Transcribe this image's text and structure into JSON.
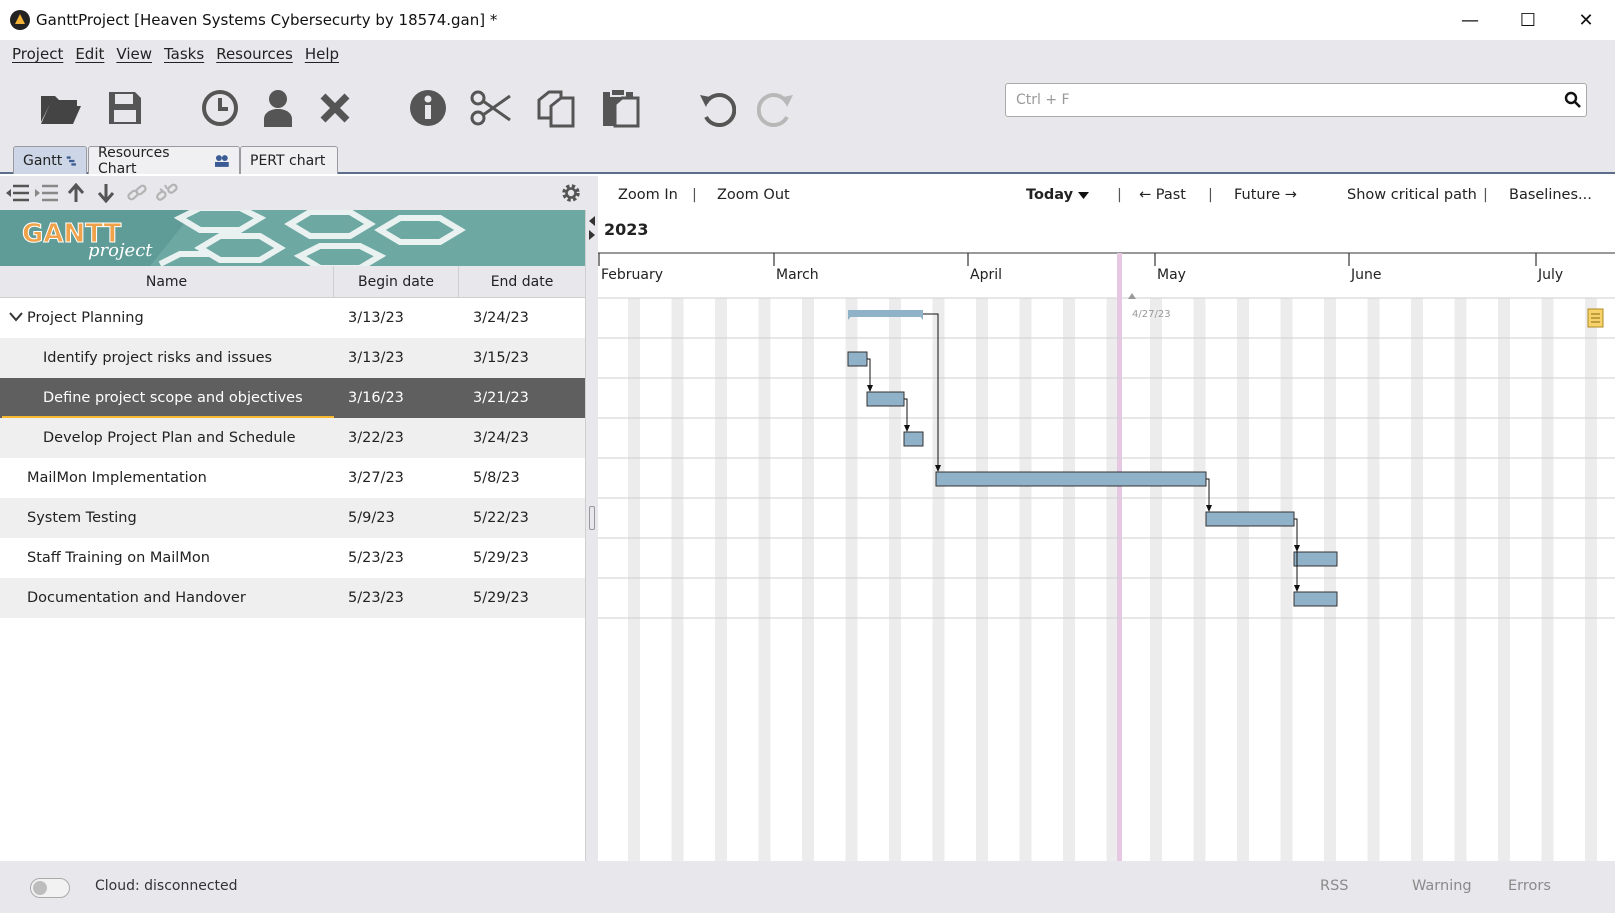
{
  "window": {
    "title": "GanttProject [Heaven Systems Cybersecurty by 18574.gan] *",
    "controls": [
      "—",
      "☐",
      "✕"
    ]
  },
  "menu": [
    "Project",
    "Edit",
    "View",
    "Tasks",
    "Resources",
    "Help"
  ],
  "toolbar": {
    "icons": [
      "folder-open-icon",
      "save-icon",
      "history-clock-icon",
      "person-icon",
      "delete-x-icon",
      "info-icon",
      "cut-scissors-icon",
      "copy-icon",
      "paste-icon",
      "undo-icon",
      "redo-icon"
    ],
    "search_placeholder": "Ctrl + F"
  },
  "tabs": [
    {
      "label": "Gantt",
      "active": true
    },
    {
      "label": "Resources Chart",
      "active": false
    },
    {
      "label": "PERT chart",
      "active": false
    }
  ],
  "table": {
    "headers": [
      "Name",
      "Begin date",
      "End date"
    ],
    "rows": [
      {
        "name": "Project Planning",
        "begin": "3/13/23",
        "end": "3/24/23",
        "level": 0,
        "expandable": true
      },
      {
        "name": "Identify project risks and issues",
        "begin": "3/13/23",
        "end": "3/15/23",
        "level": 1
      },
      {
        "name": "Define project scope and objectives",
        "begin": "3/16/23",
        "end": "3/21/23",
        "level": 1,
        "selected": true
      },
      {
        "name": "Develop Project Plan and Schedule",
        "begin": "3/22/23",
        "end": "3/24/23",
        "level": 1
      },
      {
        "name": "MailMon Implementation",
        "begin": "3/27/23",
        "end": "5/8/23",
        "level": 0
      },
      {
        "name": "System Testing",
        "begin": "5/9/23",
        "end": "5/22/23",
        "level": 0
      },
      {
        "name": "Staff Training on MailMon",
        "begin": "5/23/23",
        "end": "5/29/23",
        "level": 0
      },
      {
        "name": "Documentation and Handover",
        "begin": "5/23/23",
        "end": "5/29/23",
        "level": 0
      }
    ]
  },
  "chart_toolbar": {
    "zoom_in": "Zoom In",
    "zoom_out": "Zoom Out",
    "today": "Today",
    "past": "← Past",
    "future": "Future →",
    "critical_path": "Show critical path",
    "baselines": "Baselines..."
  },
  "timeline": {
    "year": "2023",
    "months": [
      "February",
      "March",
      "April",
      "May",
      "June",
      "July"
    ],
    "today_marker": "4/27/23"
  },
  "status": {
    "cloud": "Cloud: disconnected",
    "rss": "RSS",
    "warning": "Warning",
    "errors": "Errors"
  },
  "colors": {
    "accent": "#5d6e8c",
    "task_bar": "#8fb2c9",
    "selected_row": "#5f5f5f",
    "today_line": "#e6c8e3"
  }
}
